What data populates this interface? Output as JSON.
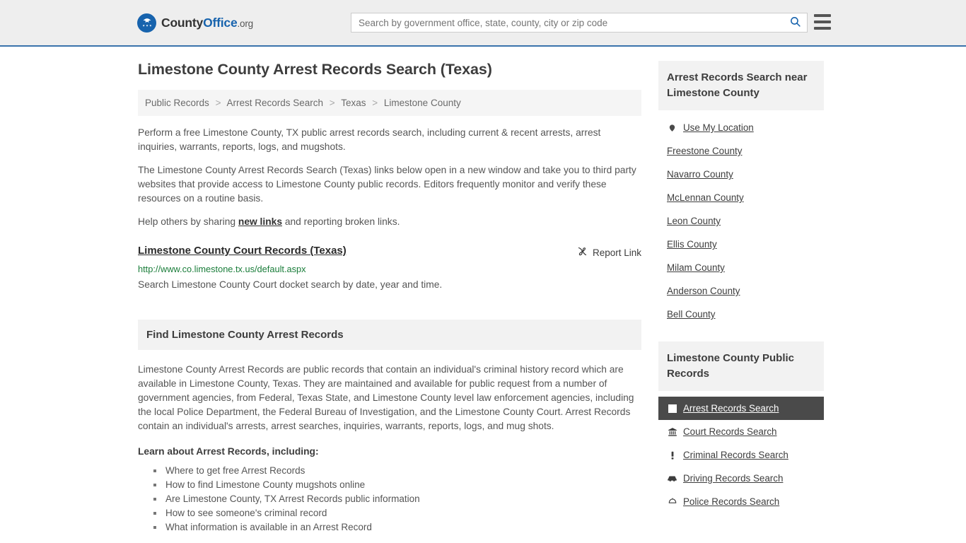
{
  "header": {
    "logo": {
      "part1": "County",
      "part2": "Office",
      "tld": ".org",
      "icon": "eagle-badge-icon"
    },
    "search": {
      "placeholder": "Search by government office, state, county, city or zip code",
      "value": ""
    },
    "search_icon": "search-icon",
    "menu_icon": "hamburger-menu-icon",
    "accent_color": "#1763ad",
    "border_color": "#3a73ab"
  },
  "page": {
    "title": "Limestone County Arrest Records Search (Texas)",
    "breadcrumb": [
      "Public Records",
      "Arrest Records Search",
      "Texas",
      "Limestone County"
    ],
    "breadcrumb_separator": ">"
  },
  "intro": {
    "p1": "Perform a free Limestone County, TX public arrest records search, including current & recent arrests, arrest inquiries, warrants, reports, logs, and mugshots.",
    "p2": "The Limestone County Arrest Records Search (Texas) links below open in a new window and take you to third party websites that provide access to Limestone County public records. Editors frequently monitor and verify these resources on a routine basis.",
    "p3_before": "Help others by sharing ",
    "p3_link": "new links",
    "p3_after": " and reporting broken links."
  },
  "result": {
    "title": "Limestone County Court Records (Texas)",
    "url": "http://www.co.limestone.tx.us/default.aspx",
    "description": "Search Limestone County Court docket search by date, year and time.",
    "report_label": "Report Link",
    "report_icon": "broken-link-icon",
    "url_color": "#1a7d3a"
  },
  "find_section": {
    "heading": "Find Limestone County Arrest Records",
    "paragraph": "Limestone County Arrest Records are public records that contain an individual's criminal history record which are available in Limestone County, Texas. They are maintained and available for public request from a number of government agencies, from Federal, Texas State, and Limestone County level law enforcement agencies, including the local Police Department, the Federal Bureau of Investigation, and the Limestone County Court. Arrest Records contain an individual's arrests, arrest searches, inquiries, warrants, reports, logs, and mug shots.",
    "learn_heading": "Learn about Arrest Records, including:",
    "bullets": [
      "Where to get free Arrest Records",
      "How to find Limestone County mugshots online",
      "Are Limestone County, TX Arrest Records public information",
      "How to see someone's criminal record",
      "What information is available in an Arrest Record"
    ]
  },
  "sidebar": {
    "nearby": {
      "heading": "Arrest Records Search near Limestone County",
      "items": [
        {
          "label": "Use My Location",
          "icon": "location-pin-icon"
        },
        {
          "label": "Freestone County",
          "icon": ""
        },
        {
          "label": "Navarro County",
          "icon": ""
        },
        {
          "label": "McLennan County",
          "icon": ""
        },
        {
          "label": "Leon County",
          "icon": ""
        },
        {
          "label": "Ellis County",
          "icon": ""
        },
        {
          "label": "Milam County",
          "icon": ""
        },
        {
          "label": "Anderson County",
          "icon": ""
        },
        {
          "label": "Bell County",
          "icon": ""
        }
      ]
    },
    "public_records": {
      "heading": "Limestone County Public Records",
      "active_bg": "#4a4a4a",
      "items": [
        {
          "label": "Arrest Records Search",
          "icon": "white-square-icon",
          "active": true
        },
        {
          "label": "Court Records Search",
          "icon": "courthouse-icon",
          "active": false
        },
        {
          "label": "Criminal Records Search",
          "icon": "exclamation-icon",
          "active": false
        },
        {
          "label": "Driving Records Search",
          "icon": "car-icon",
          "active": false
        },
        {
          "label": "Police Records Search",
          "icon": "police-badge-icon",
          "active": false
        }
      ]
    }
  }
}
